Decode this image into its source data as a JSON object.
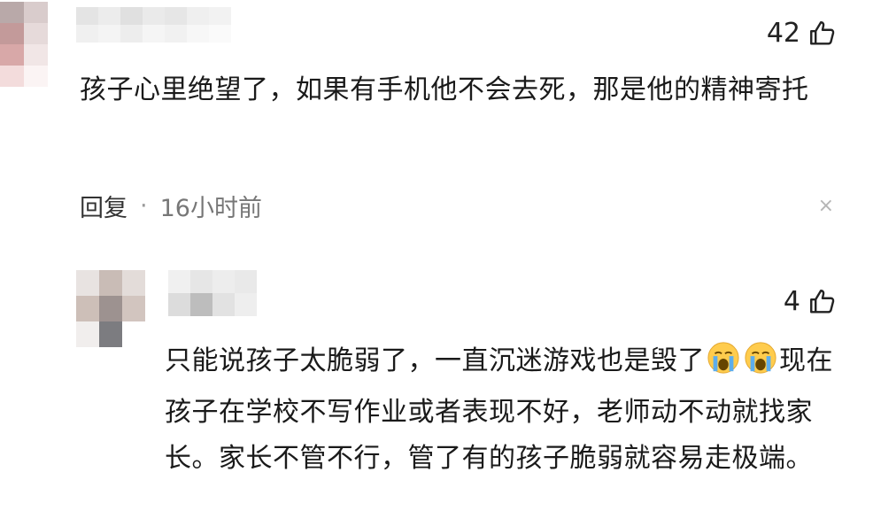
{
  "comments": [
    {
      "likes": "42",
      "text": "孩子心里绝望了，如果有手机他不会去死，那是他的精神寄托",
      "reply_label": "回复",
      "separator": "·",
      "time": "16小时前",
      "close_glyph": "×"
    },
    {
      "likes": "4",
      "text_parts": [
        "只能说孩子太脆弱了，一直沉迷游戏也是毁了",
        "现在孩子在学校不写作业或者表现不好，老师动不动就找家长。家长不管不行，管了有的孩子脆弱就容易走极端。"
      ],
      "emoji": "loudly-crying-face"
    }
  ],
  "colors": {
    "text": "#1a1a1a",
    "meta": "#777777",
    "emoji_face": "#ffcc4d",
    "emoji_tear": "#5dadec"
  }
}
